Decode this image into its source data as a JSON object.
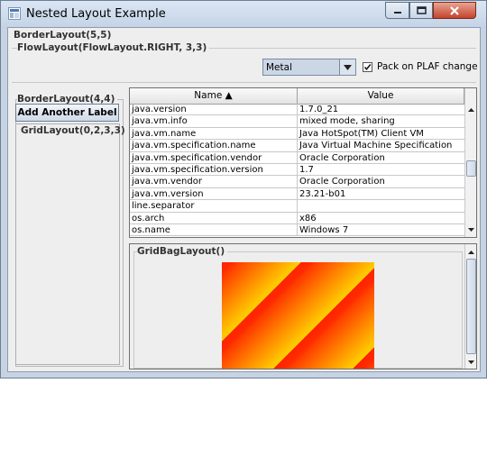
{
  "window": {
    "title": "Nested Layout Example"
  },
  "labels": {
    "border_layout_outer": "BorderLayout(5,5)",
    "flow_layout": "FlowLayout(FlowLayout.RIGHT, 3,3)",
    "border_layout_inner": "BorderLayout(4,4)",
    "grid_layout": "GridLayout(0,2,3,3)",
    "gridbag_layout": "GridBagLayout()"
  },
  "controls": {
    "laf_combo_value": "Metal",
    "pack_checkbox_label": "Pack on PLAF change",
    "pack_checked": true,
    "add_label_button": "Add Another Label"
  },
  "table": {
    "columns": [
      "Name ▲",
      "Value"
    ],
    "rows": [
      [
        "java.version",
        "1.7.0_21"
      ],
      [
        "java.vm.info",
        "mixed mode, sharing"
      ],
      [
        "java.vm.name",
        "Java HotSpot(TM) Client VM"
      ],
      [
        "java.vm.specification.name",
        "Java Virtual Machine Specification"
      ],
      [
        "java.vm.specification.vendor",
        "Oracle Corporation"
      ],
      [
        "java.vm.specification.version",
        "1.7"
      ],
      [
        "java.vm.vendor",
        "Oracle Corporation"
      ],
      [
        "java.vm.version",
        "23.21-b01"
      ],
      [
        "line.separator",
        ""
      ],
      [
        "os.arch",
        "x86"
      ],
      [
        "os.name",
        "Windows 7"
      ]
    ]
  }
}
